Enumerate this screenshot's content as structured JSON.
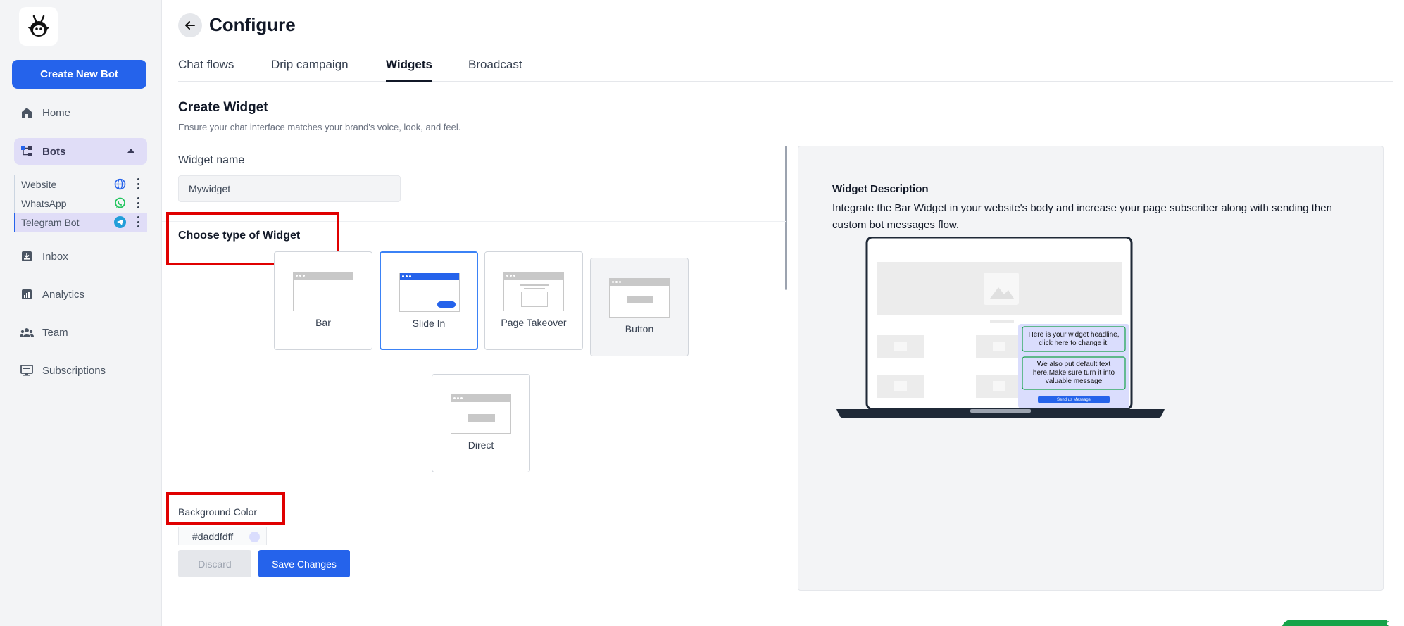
{
  "app": {
    "create_button": "Create New Bot"
  },
  "sidebar": {
    "items": [
      {
        "label": "Home",
        "icon": "home-icon"
      },
      {
        "label": "Inbox",
        "icon": "inbox-icon"
      },
      {
        "label": "Analytics",
        "icon": "analytics-icon"
      },
      {
        "label": "Team",
        "icon": "team-icon"
      },
      {
        "label": "Subscriptions",
        "icon": "subscriptions-icon"
      }
    ],
    "bots": {
      "label": "Bots",
      "channels": [
        {
          "label": "Website",
          "icon": "globe-icon",
          "color": "#2563eb"
        },
        {
          "label": "WhatsApp",
          "icon": "whatsapp-icon",
          "color": "#22c55e"
        },
        {
          "label": "Telegram Bot",
          "icon": "telegram-icon",
          "color": "#229ed9"
        }
      ]
    }
  },
  "header": {
    "title": "Configure",
    "tabs": [
      "Chat flows",
      "Drip campaign",
      "Widgets",
      "Broadcast"
    ],
    "active_tab": "Widgets"
  },
  "form": {
    "title": "Create Widget",
    "subtitle": "Ensure your chat interface matches your brand's voice, look, and feel.",
    "name_label": "Widget name",
    "name_value": "Mywidget",
    "type_label": "Choose type of Widget",
    "types": [
      "Bar",
      "Slide In",
      "Page Takeover",
      "Button",
      "Direct"
    ],
    "selected_type": "Slide In",
    "bg_label": "Background Color",
    "bg_value": "#daddfdff",
    "discard": "Discard",
    "save": "Save Changes"
  },
  "preview": {
    "title": "Widget Description",
    "text": "Integrate the Bar Widget in your website's body and increase your page subscriber along with sending then custom bot messages flow.",
    "headline": "Here is your widget headline, click here to change it.",
    "body": "We also put default text here.Make sure turn it into valuable message",
    "cta": "Send us Message"
  },
  "colors": {
    "accent": "#2563eb",
    "highlight": "#e00000",
    "bots_bg": "#e0ddf7",
    "swatch": "#daddfd"
  }
}
